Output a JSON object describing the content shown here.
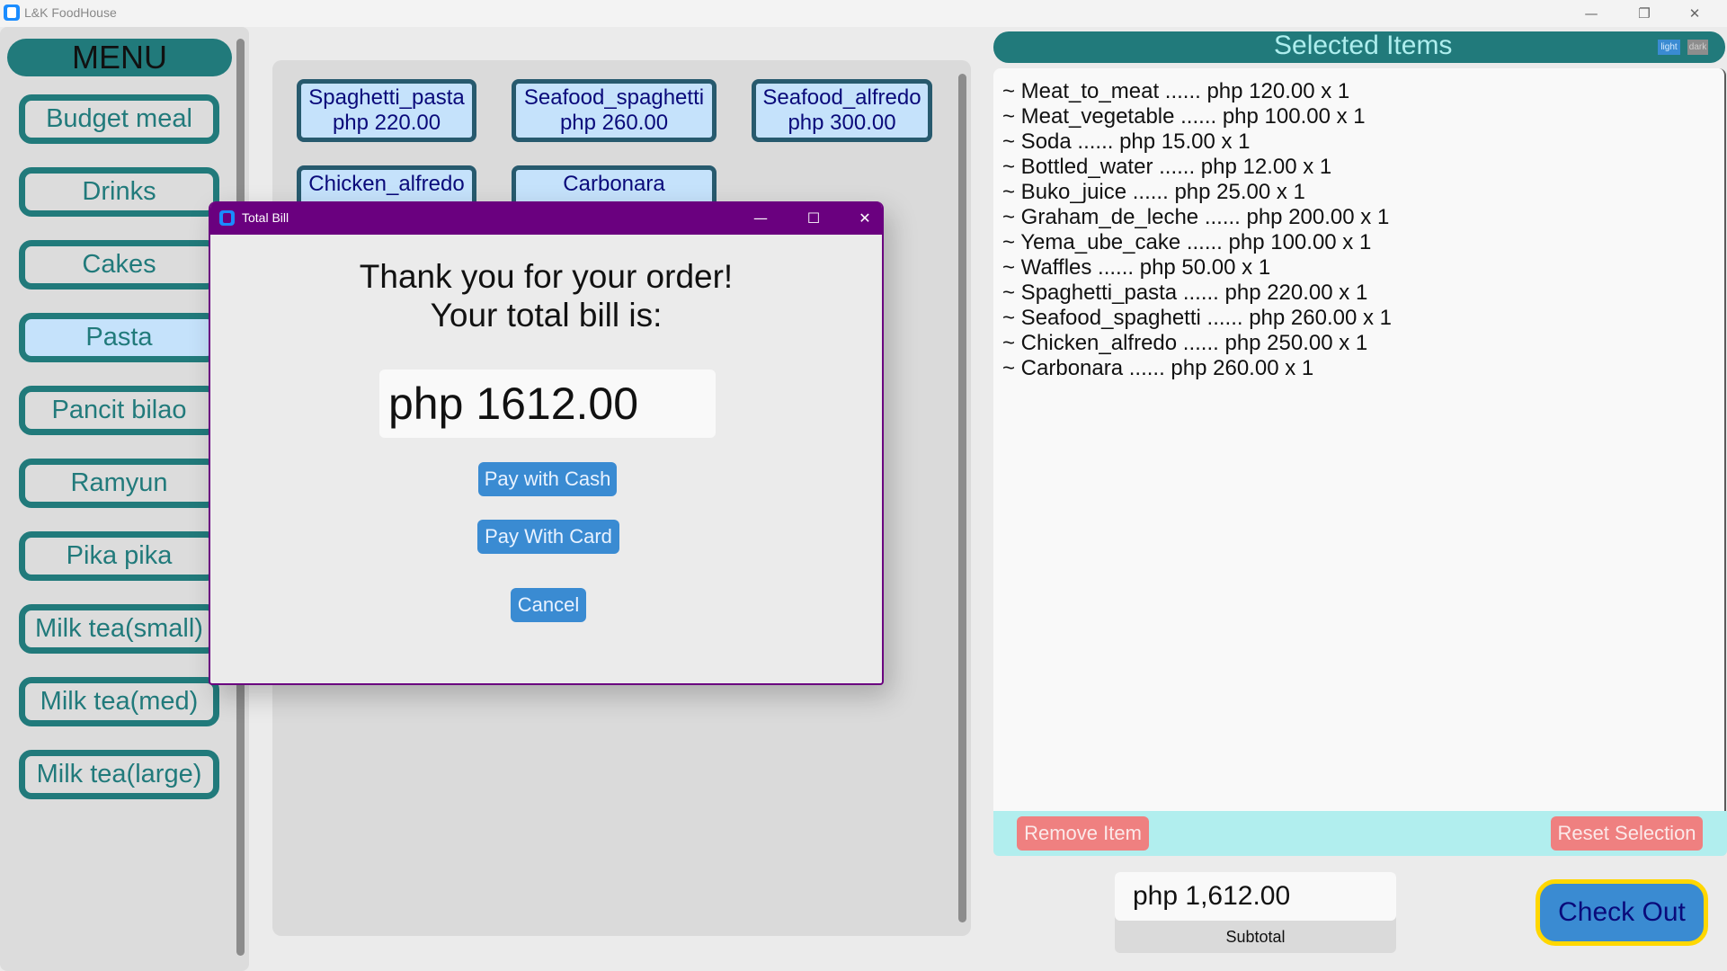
{
  "window": {
    "title": "L&K FoodHouse",
    "controls": {
      "minimize": "—",
      "maximize": "❐",
      "close": "✕"
    }
  },
  "menu": {
    "title": "MENU",
    "active": "Pasta",
    "items": [
      {
        "label": "Budget meal"
      },
      {
        "label": "Drinks"
      },
      {
        "label": "Cakes"
      },
      {
        "label": "Pasta"
      },
      {
        "label": "Pancit bilao"
      },
      {
        "label": "Ramyun"
      },
      {
        "label": "Pika pika"
      },
      {
        "label": "Milk tea(small)"
      },
      {
        "label": "Milk tea(med)"
      },
      {
        "label": "Milk tea(large)"
      }
    ]
  },
  "products": [
    {
      "name": "Spaghetti_pasta",
      "price": "php 220.00"
    },
    {
      "name": "Seafood_spaghetti",
      "price": "php 260.00"
    },
    {
      "name": "Seafood_alfredo",
      "price": "php 300.00"
    },
    {
      "name": "Chicken_alfredo",
      "price": ""
    },
    {
      "name": "Carbonara",
      "price": ""
    }
  ],
  "selected_panel": {
    "title": "Selected Items",
    "theme_light": "light",
    "theme_dark": "dark",
    "items": [
      "~ Meat_to_meat ...... php 120.00 x 1",
      "~ Meat_vegetable ...... php 100.00 x 1",
      "~ Soda ...... php 15.00 x 1",
      "~ Bottled_water ...... php 12.00 x 1",
      "~ Buko_juice ...... php 25.00 x 1",
      "~ Graham_de_leche ...... php 200.00 x 1",
      "~ Yema_ube_cake ...... php 100.00 x 1",
      "~ Waffles ...... php 50.00 x 1",
      "~ Spaghetti_pasta ...... php 220.00 x 1",
      "~ Seafood_spaghetti ...... php 260.00 x 1",
      "~ Chicken_alfredo ...... php 250.00 x 1",
      "~ Carbonara ...... php 260.00 x 1"
    ],
    "remove_label": "Remove Item",
    "reset_label": "Reset Selection",
    "subtotal_value": "php 1,612.00",
    "subtotal_label": "Subtotal",
    "checkout_label": "Check Out"
  },
  "dialog": {
    "title": "Total Bill",
    "message_line1": "Thank you for your order!",
    "message_line2": "Your total bill is:",
    "amount": "php 1612.00",
    "pay_cash_label": "Pay with Cash",
    "pay_card_label": "Pay With Card",
    "cancel_label": "Cancel",
    "controls": {
      "minimize": "—",
      "maximize": "☐",
      "close": "✕"
    }
  },
  "colors": {
    "teal": "#217a7b",
    "selected_title": "#aeeeee",
    "card_bg": "#c5e2fb",
    "card_border": "#275a6e",
    "dialog_titlebar": "#6a007f",
    "button_blue": "#3a8bd2",
    "button_red": "#ef8080",
    "checkout_border": "#ffd700"
  }
}
